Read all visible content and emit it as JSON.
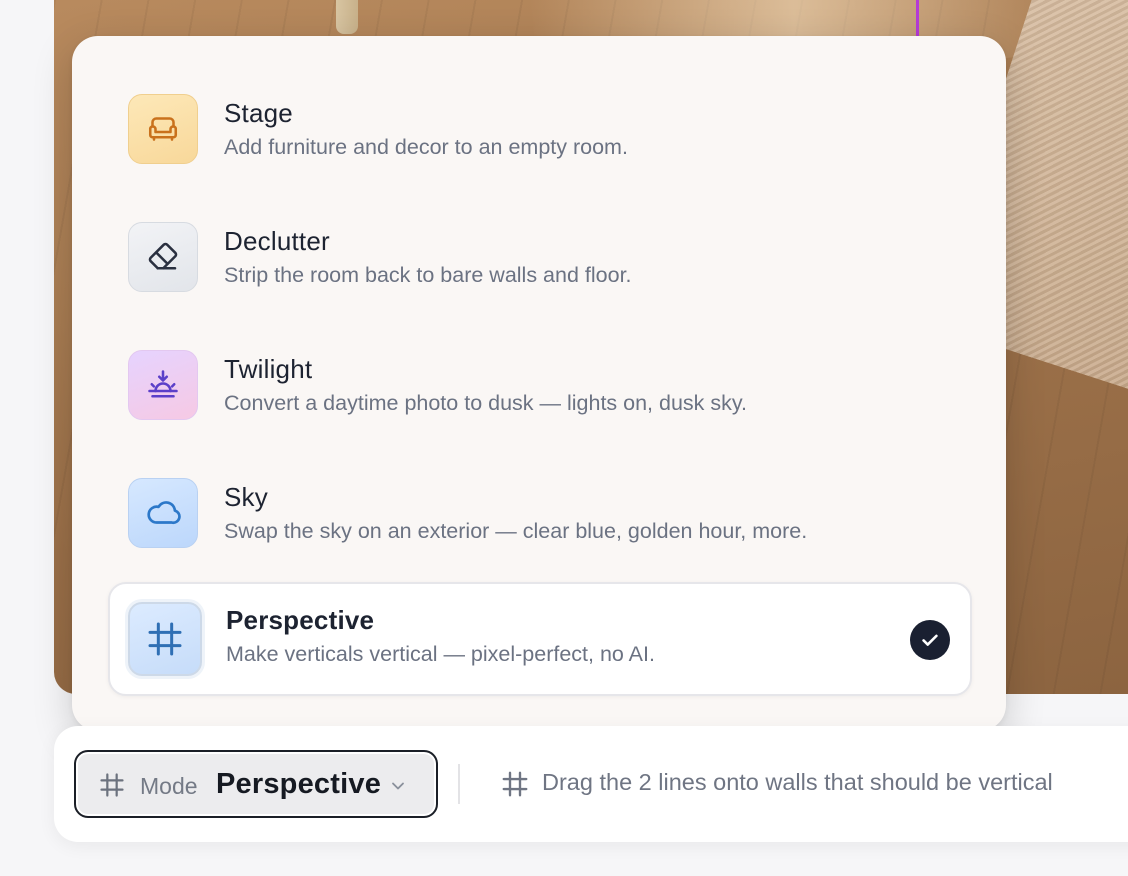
{
  "options": [
    {
      "title": "Stage",
      "description": "Add furniture and decor to an empty room.",
      "icon": "sofa-icon"
    },
    {
      "title": "Declutter",
      "description": "Strip the room back to bare walls and floor.",
      "icon": "eraser-icon"
    },
    {
      "title": "Twilight",
      "description": "Convert a daytime photo to dusk — lights on, dusk sky.",
      "icon": "sunset-icon"
    },
    {
      "title": "Sky",
      "description": "Swap the sky on an exterior — clear blue, golden hour, more.",
      "icon": "cloud-icon"
    },
    {
      "title": "Perspective",
      "description": "Make verticals vertical — pixel-perfect, no AI.",
      "icon": "grid-hash-icon",
      "selected": true
    }
  ],
  "toolbar": {
    "mode_label": "Mode",
    "mode_value": "Perspective",
    "hint": "Drag the 2 lines onto walls that should be vertical"
  },
  "colors": {
    "accent_dark": "#1a2031",
    "guide_line": "#b53bd6",
    "panel_bg": "#faf7f5"
  }
}
